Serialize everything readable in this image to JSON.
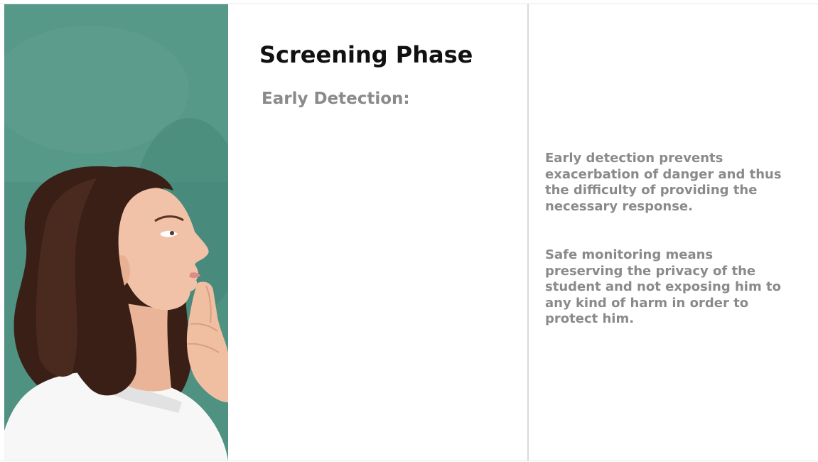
{
  "slide": {
    "title": "Screening Phase",
    "subtitle": "Early Detection:",
    "paragraphs": [
      "Early detection prevents exacerbation of danger and thus the difficulty of providing the necessary response.",
      "Safe monitoring means preserving the privacy of the student and not exposing him to any kind of harm in order to protect him."
    ]
  },
  "image": {
    "icon": "woman-thinking-photo",
    "colors": {
      "chalkboard": "#4f9282",
      "hair": "#3a1f17",
      "skin": "#f2c2a8",
      "shirt": "#f7f7f7"
    }
  },
  "colors": {
    "title": "#111111",
    "body_text": "#8a8a8a",
    "divider": "#d9d9d9",
    "background": "#ffffff"
  }
}
